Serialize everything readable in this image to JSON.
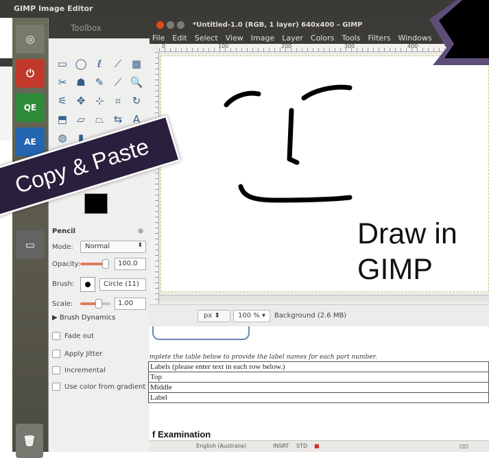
{
  "topbar": {
    "title": "GIMP Image Editor"
  },
  "launcher": {
    "items": [
      {
        "name": "dash",
        "label": "◎"
      },
      {
        "name": "power",
        "label": "⏻"
      },
      {
        "name": "qe-exam",
        "label": "QE"
      },
      {
        "name": "ae-exam",
        "label": "AE"
      },
      {
        "name": "notes",
        "label": ""
      },
      {
        "name": "screen",
        "label": ""
      },
      {
        "name": "trash",
        "label": ""
      }
    ]
  },
  "toolbox": {
    "title": "Toolbox",
    "tool_options": {
      "title": "Pencil",
      "mode_label": "Mode:",
      "mode_value": "Normal",
      "opacity_label": "Opacity:",
      "opacity_value": "100.0",
      "brush_label": "Brush:",
      "brush_value": "Circle (11)",
      "scale_label": "Scale:",
      "scale_value": "1.00",
      "brush_dynamics": "Brush Dynamics",
      "checkboxes": [
        "Fade out",
        "Apply Jitter",
        "Incremental",
        "Use color from gradient"
      ]
    }
  },
  "gimp_window": {
    "title": "*Untitled-1.0 (RGB, 1 layer) 640x400 – GIMP",
    "menu": [
      "File",
      "Edit",
      "Select",
      "View",
      "Image",
      "Layer",
      "Colors",
      "Tools",
      "Filters",
      "Windows"
    ],
    "ruler_ticks": [
      "0",
      "100",
      "200",
      "300",
      "400"
    ],
    "status": {
      "unit": "px",
      "zoom": "100 %",
      "layer_info": "Background (2.6 MB)"
    }
  },
  "document": {
    "instruction": "mplete the table below to provide the label names for each part number.",
    "table_rows": [
      "Labels (please enter text in each row below.)",
      "Top",
      "Middle",
      "Label"
    ],
    "heading": "f Examination",
    "statusbar": {
      "language": "English (Australia)",
      "insert": "INSRT",
      "std": "STD"
    }
  },
  "overlay": {
    "banner_text": "Copy & Paste",
    "callout_line1": "Draw in",
    "callout_line2": "GIMP"
  }
}
